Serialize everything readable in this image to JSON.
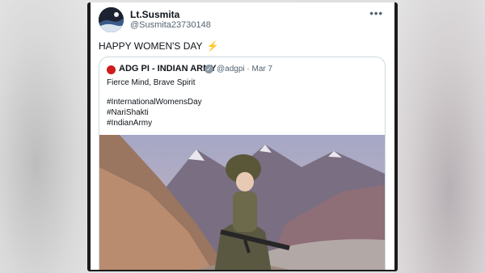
{
  "tweet": {
    "author_name": "Lt.Susmita",
    "author_handle": "@Susmita23730148",
    "text": "HAPPY WOMEN'S DAY",
    "emoji": "⚡",
    "more_icon": "more-horizontal-icon"
  },
  "quoted_tweet": {
    "author_name": "ADG PI - INDIAN ARMY",
    "verified_icon": "verified-badge-icon",
    "meta": "@adgpi · Mar 7",
    "lines": [
      "Fierce Mind, Brave Spirit",
      "#InternationalWomensDay",
      "#NariShakti",
      "#IndianArmy"
    ],
    "image": "soldier-in-mountains-photo"
  },
  "colors": {
    "text_primary": "#0f1419",
    "text_secondary": "#536471",
    "border": "#cfd9de",
    "logo_red": "#d11a1a"
  }
}
